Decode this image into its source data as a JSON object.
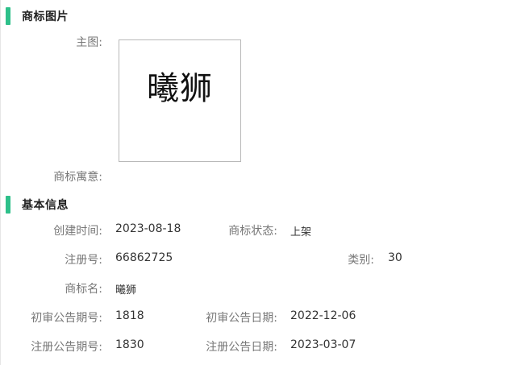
{
  "sections": {
    "image": {
      "title": "商标图片"
    },
    "basic": {
      "title": "基本信息"
    }
  },
  "image_section": {
    "main_label": "主图:",
    "logo_text": "曦狮",
    "meaning_label": "商标寓意:",
    "meaning_value": ""
  },
  "basic_info": {
    "created_label": "创建时间:",
    "created_value": "2023-08-18",
    "status_label": "商标状态:",
    "status_value": "上架",
    "reg_no_label": "注册号:",
    "reg_no_value": "66862725",
    "category_label": "类别:",
    "category_value": "30",
    "name_label": "商标名:",
    "name_value": "曦狮",
    "prelim_issue_label": "初审公告期号:",
    "prelim_issue_value": "1818",
    "prelim_date_label": "初审公告日期:",
    "prelim_date_value": "2022-12-06",
    "reg_issue_label": "注册公告期号:",
    "reg_issue_value": "1830",
    "reg_date_label": "注册公告日期:",
    "reg_date_value": "2023-03-07"
  },
  "colors": {
    "accent": "#2ec08a"
  }
}
